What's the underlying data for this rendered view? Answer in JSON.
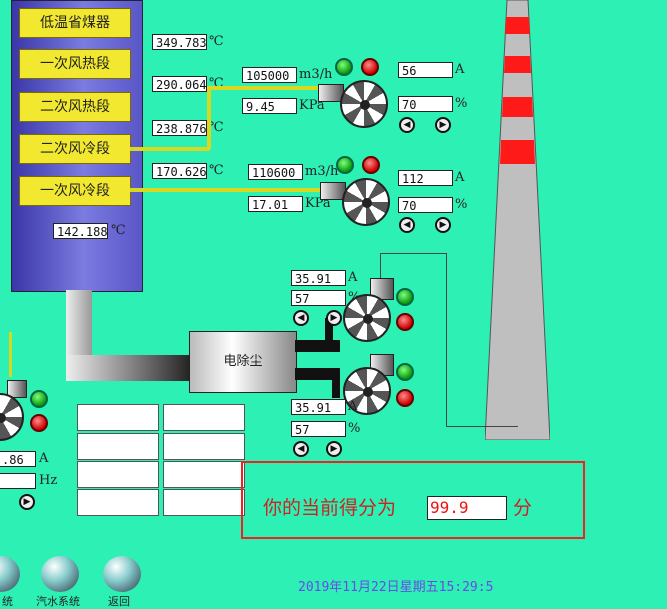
{
  "tower": {
    "sections": [
      "低温省煤器",
      "一次风热段",
      "二次风热段",
      "二次风冷段",
      "一次风冷段"
    ],
    "temps": [
      {
        "value": "349.783",
        "unit": "℃"
      },
      {
        "value": "290.064",
        "unit": "℃"
      },
      {
        "value": "238.876",
        "unit": "℃"
      },
      {
        "value": "170.626",
        "unit": "℃"
      },
      {
        "value": "142.188",
        "unit": "℃"
      }
    ]
  },
  "fan1": {
    "flow": "105000",
    "flow_unit": "m3/h",
    "pressure": "9.45",
    "pressure_unit": "KPa",
    "current": "56",
    "current_unit": "A",
    "opening": "70",
    "opening_unit": "%"
  },
  "fan2": {
    "flow": "110600",
    "flow_unit": "m3/h",
    "pressure": "17.01",
    "pressure_unit": "KPa",
    "current": "112",
    "current_unit": "A",
    "opening": "70",
    "opening_unit": "%"
  },
  "idfan1": {
    "current": "35.91",
    "current_unit": "A",
    "opening": "57",
    "opening_unit": "%"
  },
  "idfan2": {
    "current": "35.91",
    "current_unit": "A",
    "opening": "57",
    "opening_unit": "%"
  },
  "leftfan": {
    "current": ".86",
    "current_unit": "A",
    "freq_unit": "Hz"
  },
  "precipitator": {
    "label": "电除尘"
  },
  "score": {
    "prefix": "你的当前得分为",
    "value": "99.9",
    "suffix": "分"
  },
  "datetime": "2019年11月22日星期五15:29:5",
  "nav": [
    "统",
    "汽水系统",
    "返回"
  ],
  "colors": {
    "background": "#2df0b4",
    "score_border": "#e22",
    "score_text": "#c22",
    "pipe_yellow": "#d8d820"
  }
}
